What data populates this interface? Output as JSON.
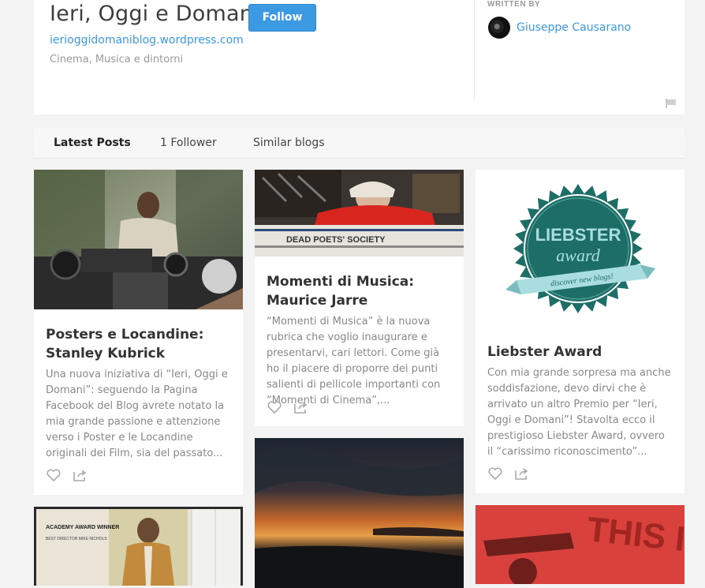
{
  "header": {
    "title": "Ieri, Oggi e Domani",
    "follow_label": "Follow",
    "url": "ierioggidomaniblog.wordpress.com",
    "tagline": "Cinema, Musica e dintorni",
    "written_by_label": "WRITTEN BY",
    "author": "Giuseppe Causarano"
  },
  "tabs": [
    {
      "label": "Latest Posts",
      "active": true
    },
    {
      "label": "1 Follower",
      "active": false
    },
    {
      "label": "Similar blogs",
      "active": false
    }
  ],
  "posts": [
    {
      "title": "Posters e Locandine: Stanley Kubrick",
      "excerpt": "Una nuova iniziativa di “Ieri, Oggi e Domani”: seguendo la Pagina Facebook del Blog avrete notato la mia grande passione e attenzione verso i Poster e le Locandine originali dei Film, sia del passato..."
    },
    {
      "title": "Momenti di Musica: Maurice Jarre",
      "excerpt": "“Momenti di Musica” è la nuova rubrica che voglio inaugurare e presentarvi, cari lettori. Come già ho il piacere di proporre dei punti salienti di pellicole importanti con “Momenti di Cinema”,..."
    },
    {
      "title": "Liebster Award",
      "excerpt": "Con mia grande sorpresa ma anche soddisfazione, devo dirvi che è arrivato un altro Premio per “Ieri, Oggi e Domani”! Stavolta ecco il prestigioso Liebster Award, ovvero il “carissimo riconoscimento”..."
    }
  ],
  "images": {
    "liebster_badge": {
      "line1": "LIEBSTER",
      "line2": "award",
      "ribbon": "discover new blogs!"
    },
    "book_spine": "DEAD POETS' SOCIETY",
    "poster_top": "ACADEMY AWARD WINNER",
    "poster_sub": "BEST DIRECTOR MIKE NICHOLS",
    "red_poster": "THIS IS MY BO"
  },
  "colors": {
    "accent": "#3b9ae2",
    "badge_green": "#1e6e68",
    "ribbon": "#a9dde0",
    "red_poster": "#d9413c"
  }
}
